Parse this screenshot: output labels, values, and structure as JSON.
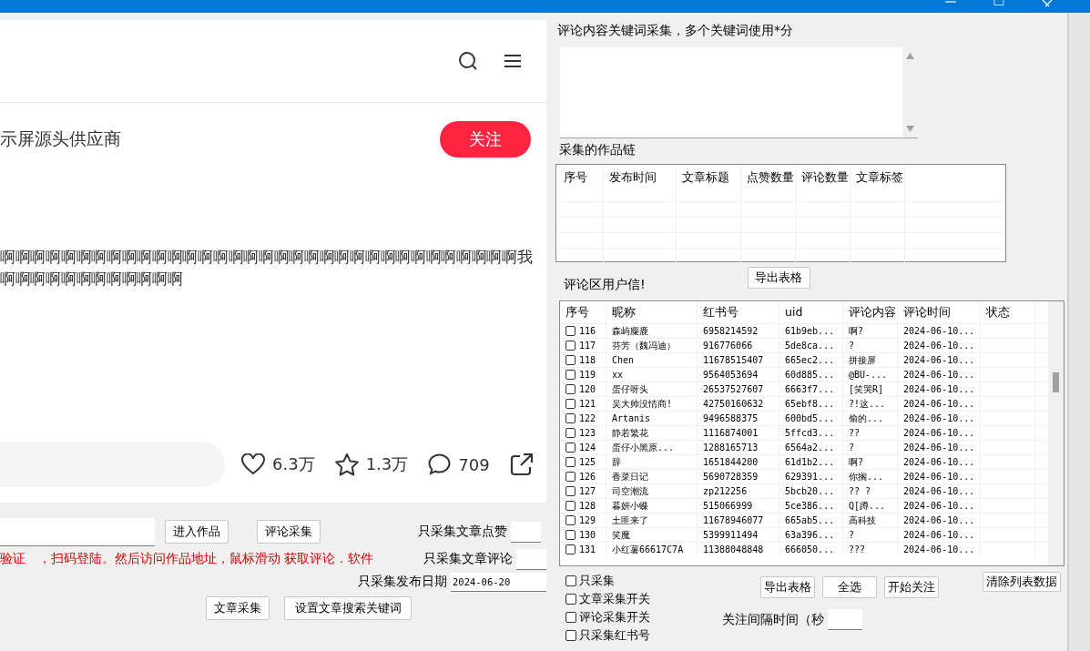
{
  "webpage": {
    "author": "示屏源头供应商",
    "follow_button": "关注",
    "content_lines": [
      "啊啊啊啊啊啊啊啊啊啊啊啊啊啊啊啊啊啊啊啊啊啊啊啊啊啊啊啊啊啊啊啊啊啊我",
      "啊啊啊啊啊啊啊啊啊啊啊啊"
    ],
    "stats": [
      {
        "kind": "like",
        "count": "6.3万"
      },
      {
        "kind": "star",
        "count": "1.3万"
      },
      {
        "kind": "comment",
        "count": "709"
      },
      {
        "kind": "share"
      }
    ]
  },
  "left_form": {
    "enter_button": "进入作品",
    "comment_collect_button": "评论采集",
    "notice": "验证　，扫码登陆。然后访问作品地址，鼠标滑动 获取评论．软件",
    "like_filter_label": "只采集文章点赞",
    "comment_filter_label": "只采集文章评论",
    "date_filter_label": "只采集发布日期",
    "date_value": "2024-06-20",
    "article_collect_button": "文章采集",
    "keyword_button": "设置文章搜索关键词"
  },
  "keywords": {
    "label": "评论内容关键词采集，多个关键词使用*分"
  },
  "works": {
    "label": "采集的作品链",
    "columns": [
      "序号",
      "发布时间",
      "文章标题",
      "点赞数量",
      "评论数量",
      "文章标签"
    ],
    "export_button": "导出表格"
  },
  "users": {
    "label": "评论区用户信!",
    "columns": [
      "序号",
      "昵称",
      "红书号",
      "uid",
      "评论内容",
      "评论时间",
      "状态"
    ],
    "rows": [
      {
        "checked": false,
        "no": "116",
        "nick": "森屿麋鹿",
        "red_id": "6958214592",
        "uid": "61b9eb...",
        "comment": "啊?",
        "time": "2024-06-10..."
      },
      {
        "checked": false,
        "no": "117",
        "nick": "芬芳（魏冯迪）",
        "red_id": "916776066",
        "uid": "5de8ca...",
        "comment": "?",
        "time": "2024-06-10..."
      },
      {
        "checked": false,
        "no": "118",
        "nick": "Chen",
        "red_id": "11678515407",
        "uid": "665ec2...",
        "comment": "拼接屏",
        "time": "2024-06-10..."
      },
      {
        "checked": false,
        "no": "119",
        "nick": "xx",
        "red_id": "9564053694",
        "uid": "60d885...",
        "comment": "@BU-...",
        "time": "2024-06-10..."
      },
      {
        "checked": false,
        "no": "120",
        "nick": "蛋仔呀头",
        "red_id": "26537527607",
        "uid": "6663f7...",
        "comment": "[笑哭R]",
        "time": "2024-06-10..."
      },
      {
        "checked": false,
        "no": "121",
        "nick": "吴大帅没情商!",
        "red_id": "42750160632",
        "uid": "65ebf8...",
        "comment": "?!这...",
        "time": "2024-06-10..."
      },
      {
        "checked": false,
        "no": "122",
        "nick": "Artanis",
        "red_id": "9496588375",
        "uid": "600bd5...",
        "comment": "偷的...",
        "time": "2024-06-10..."
      },
      {
        "checked": false,
        "no": "123",
        "nick": "静若繁花",
        "red_id": "1116874001",
        "uid": "5ffcd3...",
        "comment": "??",
        "time": "2024-06-10..."
      },
      {
        "checked": false,
        "no": "124",
        "nick": "蛋仔小黑原...",
        "red_id": "1288165713",
        "uid": "6564a2...",
        "comment": "?",
        "time": "2024-06-10..."
      },
      {
        "checked": false,
        "no": "125",
        "nick": "辞",
        "red_id": "1651844200",
        "uid": "61d1b2...",
        "comment": "啊?",
        "time": "2024-06-10..."
      },
      {
        "checked": false,
        "no": "126",
        "nick": "香菜日记",
        "red_id": "5690728359",
        "uid": "629391...",
        "comment": "你搁...",
        "time": "2024-06-10..."
      },
      {
        "checked": false,
        "no": "127",
        "nick": "司空潮流",
        "red_id": "zp212256",
        "uid": "5bcb20...",
        "comment": "?? ?",
        "time": "2024-06-10..."
      },
      {
        "checked": false,
        "no": "128",
        "nick": "暮妍小蝶",
        "red_id": "515066999",
        "uid": "5ce386...",
        "comment": "Q[蹲...",
        "time": "2024-06-10..."
      },
      {
        "checked": false,
        "no": "129",
        "nick": "土匪来了",
        "red_id": "11678946077",
        "uid": "665ab5...",
        "comment": "高科技",
        "time": "2024-06-10..."
      },
      {
        "checked": false,
        "no": "130",
        "nick": "笑魔",
        "red_id": "5399911494",
        "uid": "63a396...",
        "comment": "?",
        "time": "2024-06-10..."
      },
      {
        "checked": false,
        "no": "131",
        "nick": "小红薯66617C7A",
        "red_id": "11388048848",
        "uid": "666050...",
        "comment": "???",
        "time": "2024-06-10..."
      }
    ]
  },
  "options": [
    {
      "label": "只采集",
      "checked": false
    },
    {
      "label": "文章采集开关",
      "checked": false
    },
    {
      "label": "评论采集开关",
      "checked": false
    },
    {
      "label": "只采集红书号",
      "checked": false
    }
  ],
  "actions": [
    "导出表格",
    "全选",
    "开始关注"
  ],
  "clear_button": "清除列表数据",
  "interval_label": "关注间隔时间（秒"
}
